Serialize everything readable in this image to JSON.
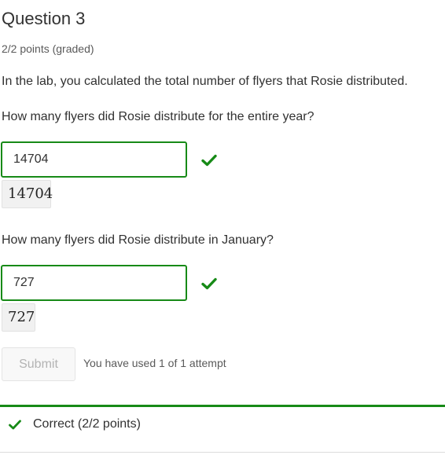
{
  "question": {
    "title": "Question 3",
    "points": "2/2 points (graded)",
    "intro": "In the lab, you calculated the total number of flyers that Rosie distributed."
  },
  "parts": [
    {
      "prompt": "How many flyers did Rosie distribute for the entire year?",
      "value": "14704",
      "preview": "14704",
      "status": "correct",
      "status_icon": "checkmark-icon"
    },
    {
      "prompt": "How many flyers did Rosie distribute in January?",
      "value": "727",
      "preview": "727",
      "status": "correct",
      "status_icon": "checkmark-icon"
    }
  ],
  "actions": {
    "submit_label": "Submit",
    "submit_disabled": true,
    "attempts_text": "You have used 1 of 1 attempt"
  },
  "notification": {
    "text": "Correct (2/2 points)",
    "icon": "checkmark-icon"
  },
  "colors": {
    "correct": "#178a17",
    "text": "#313131",
    "muted": "#5a5a5a",
    "preview_bg": "#f1f1f1"
  }
}
